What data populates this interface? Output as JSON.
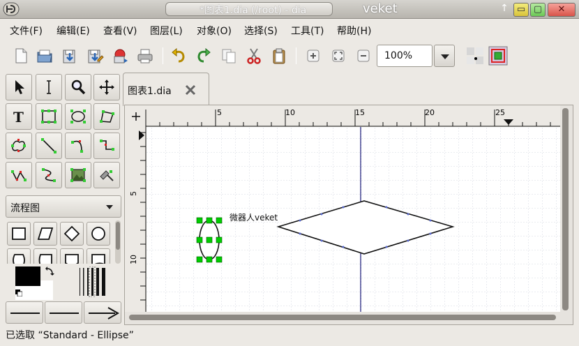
{
  "window": {
    "title": "*图表1.dia (/root) - dia",
    "app_name": "veket",
    "buttons": {
      "minimize": "▭",
      "maximize": "▢",
      "close": "✕",
      "pin": "↑"
    }
  },
  "menu": [
    {
      "label": "文件(F)"
    },
    {
      "label": "编辑(E)"
    },
    {
      "label": "查看(V)"
    },
    {
      "label": "图层(L)"
    },
    {
      "label": "对象(O)"
    },
    {
      "label": "选择(S)"
    },
    {
      "label": "工具(T)"
    },
    {
      "label": "帮助(H)"
    }
  ],
  "toolbar": {
    "zoom_value": "100%",
    "icons": [
      "new-file-icon",
      "open-icon",
      "save-icon",
      "save-as-icon",
      "export-icon",
      "print-icon",
      "undo-icon",
      "redo-icon",
      "copy-icon",
      "cut-icon",
      "paste-icon",
      "zoom-in-icon",
      "zoom-fit-icon",
      "zoom-out-icon",
      "snap-grid-icon",
      "snap-object-icon"
    ]
  },
  "tools": [
    "pointer-tool-icon",
    "text-cursor-tool-icon",
    "magnify-tool-icon",
    "move-tool-icon",
    "text-tool-icon",
    "box-tool-icon",
    "ellipse-tool-icon",
    "polygon-tool-icon",
    "beziergon-tool-icon",
    "line-tool-icon",
    "arc-tool-icon",
    "zigzag-tool-icon",
    "polyline-tool-icon",
    "bezier-tool-icon",
    "image-tool-icon",
    "outline-tool-icon"
  ],
  "sheet": {
    "selected": "流程图"
  },
  "document_tab": {
    "label": "图表1.dia"
  },
  "ruler": {
    "horizontal_ticks": [
      "5",
      "10",
      "15",
      "20",
      "25"
    ],
    "vertical_ticks": [
      "5",
      "10"
    ]
  },
  "canvas": {
    "text_label": "微器人veket"
  },
  "colors": {
    "foreground": "#000000",
    "background": "#ffffff",
    "accent_handle": "#00cc00",
    "guide": "#1a1a7a"
  },
  "status": {
    "text": "已选取 “Standard - Ellipse”"
  }
}
